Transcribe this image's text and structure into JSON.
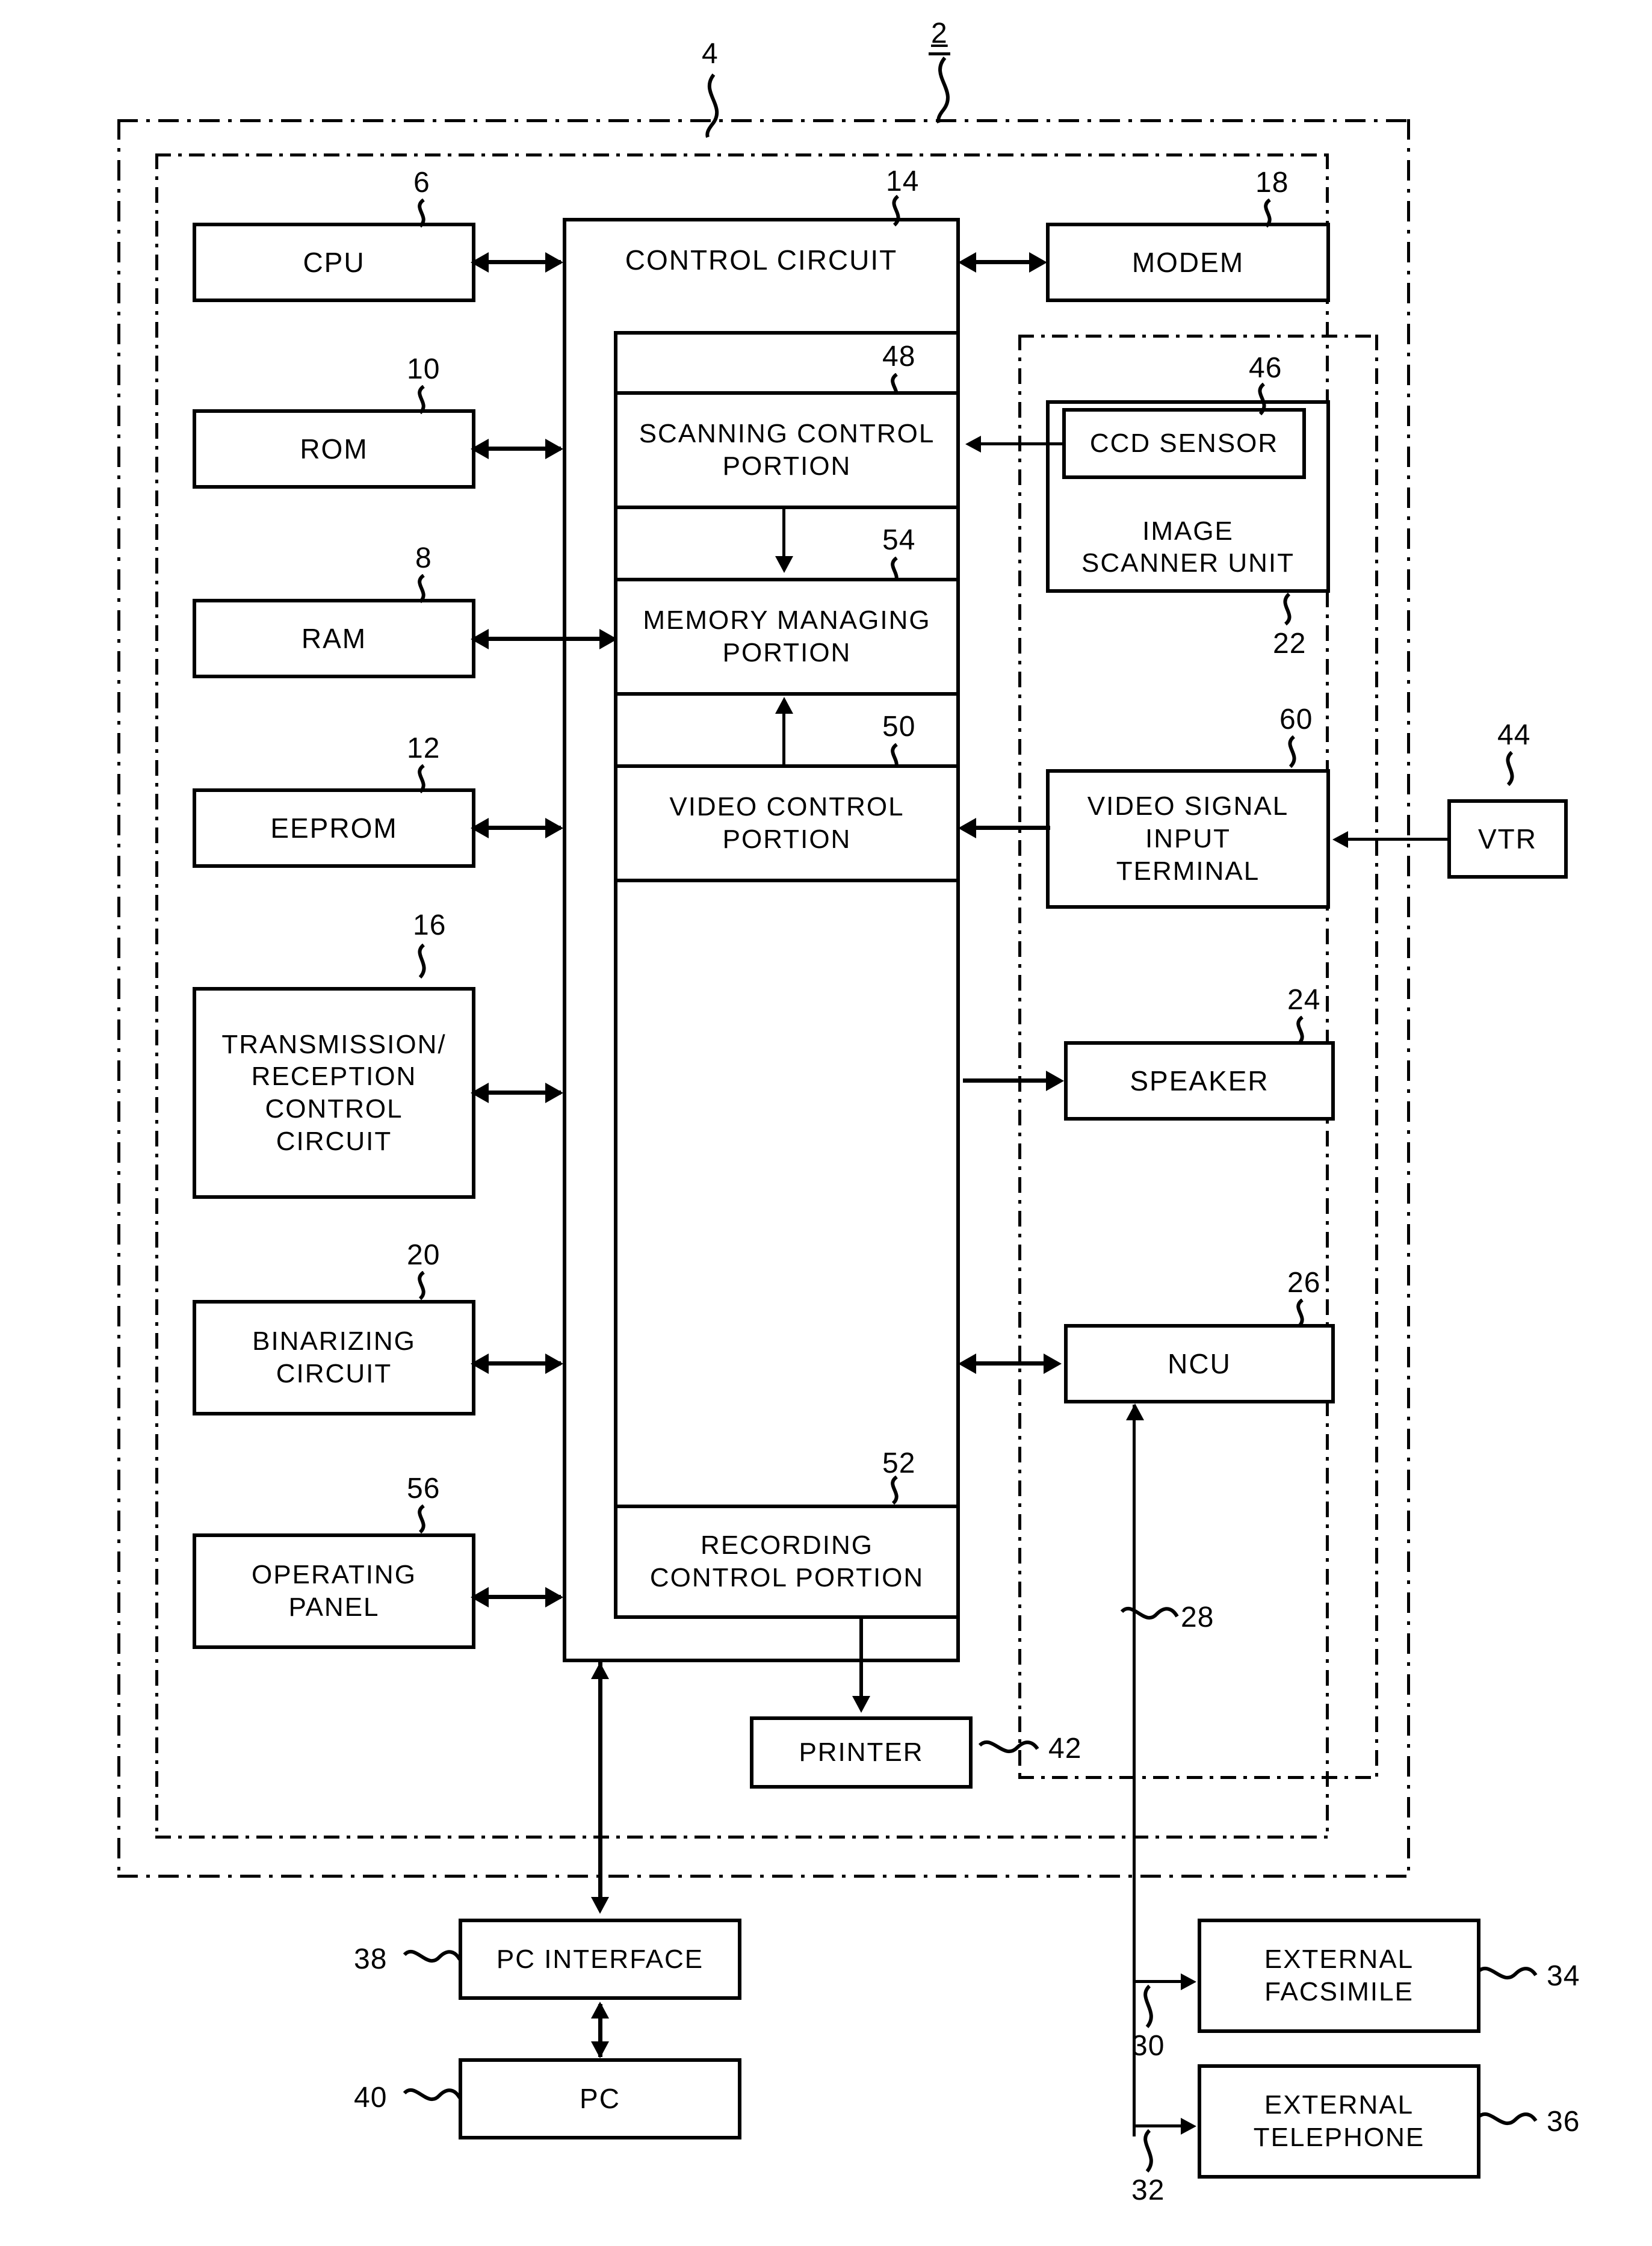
{
  "figure": {
    "type": "patent-block-diagram",
    "enclosures": [
      {
        "ref": "2",
        "style": "dash-dot",
        "note": "outer apparatus boundary"
      },
      {
        "ref": "4",
        "style": "dotted",
        "note": "inner facsimile main-unit boundary"
      },
      {
        "ref": "",
        "style": "dotted",
        "note": "right-hand image-input section boundary"
      }
    ],
    "blocks": [
      {
        "ref": "6",
        "label": [
          "CPU"
        ]
      },
      {
        "ref": "10",
        "label": [
          "ROM"
        ]
      },
      {
        "ref": "8",
        "label": [
          "RAM"
        ]
      },
      {
        "ref": "12",
        "label": [
          "EEPROM"
        ]
      },
      {
        "ref": "16",
        "label": [
          "TRANSMISSION/",
          "RECEPTION",
          "CONTROL",
          "CIRCUIT"
        ]
      },
      {
        "ref": "20",
        "label": [
          "BINARIZING",
          "CIRCUIT"
        ]
      },
      {
        "ref": "56",
        "label": [
          "OPERATING",
          "PANEL"
        ]
      },
      {
        "ref": "14",
        "label": [
          "CONTROL CIRCUIT"
        ]
      },
      {
        "ref": "48",
        "label": [
          "SCANNING CONTROL",
          "PORTION"
        ]
      },
      {
        "ref": "54",
        "label": [
          "MEMORY MANAGING",
          "PORTION"
        ]
      },
      {
        "ref": "50",
        "label": [
          "VIDEO CONTROL",
          "PORTION"
        ]
      },
      {
        "ref": "52",
        "label": [
          "RECORDING",
          "CONTROL PORTION"
        ]
      },
      {
        "ref": "18",
        "label": [
          "MODEM"
        ]
      },
      {
        "ref": "46",
        "label": [
          "CCD SENSOR"
        ]
      },
      {
        "ref": "22",
        "label": [
          "IMAGE",
          "SCANNER UNIT"
        ]
      },
      {
        "ref": "60",
        "label": [
          "VIDEO SIGNAL",
          "INPUT",
          "TERMINAL"
        ]
      },
      {
        "ref": "44",
        "label": [
          "VTR"
        ]
      },
      {
        "ref": "24",
        "label": [
          "SPEAKER"
        ]
      },
      {
        "ref": "26",
        "label": [
          "NCU"
        ]
      },
      {
        "ref": "42",
        "label": [
          "PRINTER"
        ]
      },
      {
        "ref": "38",
        "label": [
          "PC INTERFACE"
        ]
      },
      {
        "ref": "40",
        "label": [
          "PC"
        ]
      },
      {
        "ref": "34",
        "label": [
          "EXTERNAL",
          "FACSIMILE"
        ]
      },
      {
        "ref": "36",
        "label": [
          "EXTERNAL",
          "TELEPHONE"
        ]
      }
    ],
    "line_refs": [
      {
        "ref": "28",
        "note": "telephone line from NCU"
      },
      {
        "ref": "30",
        "note": "branch to external facsimile"
      },
      {
        "ref": "32",
        "note": "branch to external telephone"
      }
    ]
  },
  "labels": {
    "cpu": "CPU",
    "rom": "ROM",
    "ram": "RAM",
    "eeprom": "EEPROM",
    "trc_1": "TRANSMISSION/",
    "trc_2": "RECEPTION",
    "trc_3": "CONTROL",
    "trc_4": "CIRCUIT",
    "bin_1": "BINARIZING",
    "bin_2": "CIRCUIT",
    "op_1": "OPERATING",
    "op_2": "PANEL",
    "control_circuit": "CONTROL CIRCUIT",
    "scan_1": "SCANNING CONTROL",
    "scan_2": "PORTION",
    "mem_1": "MEMORY MANAGING",
    "mem_2": "PORTION",
    "vid_1": "VIDEO CONTROL",
    "vid_2": "PORTION",
    "rec_1": "RECORDING",
    "rec_2": "CONTROL PORTION",
    "modem": "MODEM",
    "ccd": "CCD SENSOR",
    "isu_1": "IMAGE",
    "isu_2": "SCANNER UNIT",
    "vst_1": "VIDEO SIGNAL",
    "vst_2": "INPUT",
    "vst_3": "TERMINAL",
    "vtr": "VTR",
    "speaker": "SPEAKER",
    "ncu": "NCU",
    "printer": "PRINTER",
    "pc_if": "PC INTERFACE",
    "pc": "PC",
    "efax_1": "EXTERNAL",
    "efax_2": "FACSIMILE",
    "etel_1": "EXTERNAL",
    "etel_2": "TELEPHONE"
  },
  "refs": {
    "n2": "2",
    "n4": "4",
    "n6": "6",
    "n8": "8",
    "n10": "10",
    "n12": "12",
    "n14": "14",
    "n16": "16",
    "n18": "18",
    "n20": "20",
    "n22": "22",
    "n24": "24",
    "n26": "26",
    "n28": "28",
    "n30": "30",
    "n32": "32",
    "n34": "34",
    "n36": "36",
    "n38": "38",
    "n40": "40",
    "n42": "42",
    "n44": "44",
    "n46": "46",
    "n48": "48",
    "n50": "50",
    "n52": "52",
    "n54": "54",
    "n56": "56",
    "n60": "60"
  },
  "colors": {
    "ink": "#000000",
    "paper": "#ffffff"
  }
}
